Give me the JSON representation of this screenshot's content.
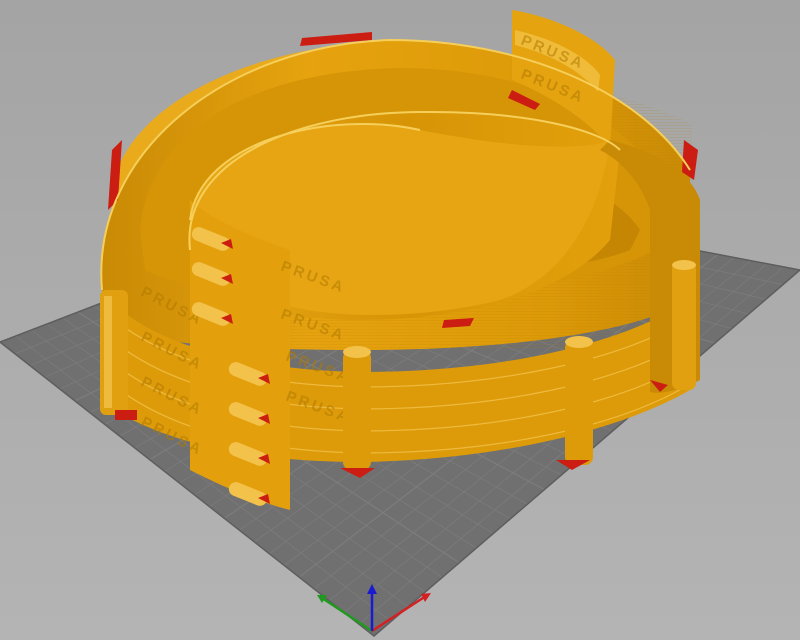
{
  "app": {
    "view": "3D print preview"
  },
  "viewport": {
    "background_color": "#a9a9a9",
    "bed": {
      "grid_color": "#7d7d7d",
      "fill_color": "#707070",
      "visible": true
    },
    "model": {
      "name": "",
      "embossed_text": "PRUSA",
      "colors": {
        "perimeter": "#e3a00c",
        "perimeter_dark": "#c98a05",
        "perimeter_light": "#f3c24a",
        "overhang": "#cc1d12"
      }
    },
    "axes": {
      "x_color": "#d42020",
      "y_color": "#1f9a1f",
      "z_color": "#1a1ad0"
    }
  }
}
